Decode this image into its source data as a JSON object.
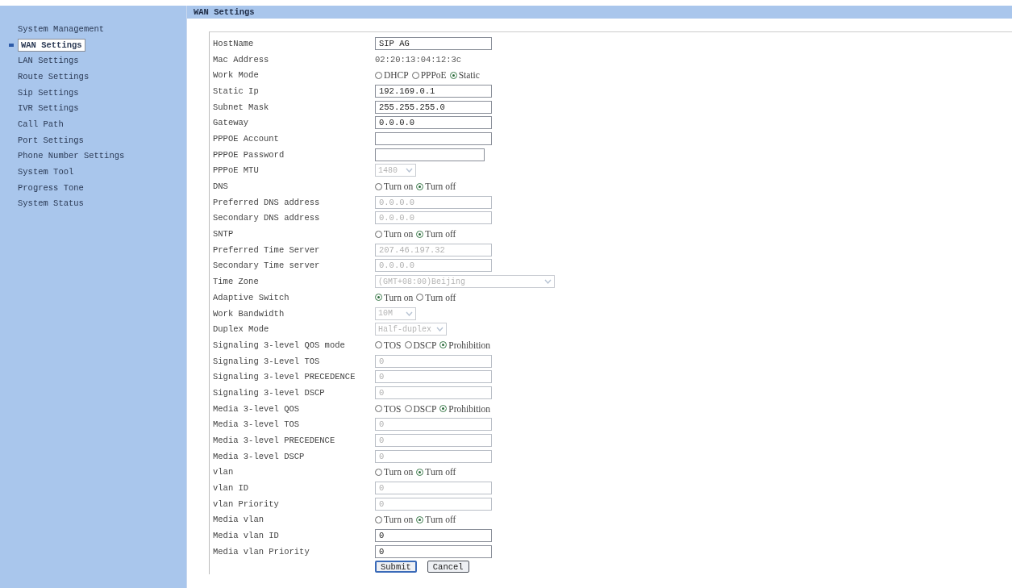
{
  "sidebar": {
    "items": [
      {
        "label": "System Management",
        "selected": false
      },
      {
        "label": "WAN Settings",
        "selected": true
      },
      {
        "label": "LAN Settings",
        "selected": false
      },
      {
        "label": "Route Settings",
        "selected": false
      },
      {
        "label": "Sip Settings",
        "selected": false
      },
      {
        "label": "IVR Settings",
        "selected": false
      },
      {
        "label": "Call Path",
        "selected": false
      },
      {
        "label": "Port Settings",
        "selected": false
      },
      {
        "label": "Phone Number Settings",
        "selected": false
      },
      {
        "label": "System Tool",
        "selected": false
      },
      {
        "label": "Progress Tone",
        "selected": false
      },
      {
        "label": "System Status",
        "selected": false
      }
    ]
  },
  "header": {
    "title": "WAN Settings"
  },
  "form": {
    "rows": [
      {
        "label": "HostName",
        "kind": "text",
        "value": "SIP AG",
        "disabled": false
      },
      {
        "label": "Mac Address",
        "kind": "static",
        "value": "02:20:13:04:12:3c"
      },
      {
        "label": "Work Mode",
        "kind": "radio",
        "options": [
          {
            "label": "DHCP",
            "selected": false
          },
          {
            "label": "PPPoE",
            "selected": false
          },
          {
            "label": "Static",
            "selected": true
          }
        ]
      },
      {
        "label": "Static Ip",
        "kind": "text",
        "value": "192.169.0.1",
        "disabled": false
      },
      {
        "label": "Subnet Mask",
        "kind": "text",
        "value": "255.255.255.0",
        "disabled": false
      },
      {
        "label": "Gateway",
        "kind": "text",
        "value": "0.0.0.0",
        "disabled": false
      },
      {
        "label": "PPPOE Account",
        "kind": "text",
        "disabled": false
      },
      {
        "label": "PPPOE Password",
        "kind": "password",
        "disabled": false
      },
      {
        "label": "PPPoE MTU",
        "kind": "select",
        "value": "1480",
        "disabled": true
      },
      {
        "label": "DNS",
        "kind": "radio",
        "options": [
          {
            "label": "Turn on",
            "selected": false
          },
          {
            "label": "Turn off",
            "selected": true
          }
        ]
      },
      {
        "label": "Preferred DNS address",
        "kind": "text",
        "value": "0.0.0.0",
        "disabled": true
      },
      {
        "label": "Secondary DNS address",
        "kind": "text",
        "value": "0.0.0.0",
        "disabled": true
      },
      {
        "label": "SNTP",
        "kind": "radio",
        "options": [
          {
            "label": "Turn on",
            "selected": false
          },
          {
            "label": "Turn off",
            "selected": true
          }
        ]
      },
      {
        "label": "Preferred Time Server",
        "kind": "text",
        "value": "207.46.197.32",
        "disabled": true
      },
      {
        "label": "Secondary Time server",
        "kind": "text",
        "value": "0.0.0.0",
        "disabled": true
      },
      {
        "label": "Time Zone",
        "kind": "select",
        "value": "(GMT+08:00)Beijing",
        "wide": true,
        "disabled": true
      },
      {
        "label": "Adaptive Switch",
        "kind": "radio",
        "options": [
          {
            "label": "Turn on",
            "selected": true
          },
          {
            "label": "Turn off",
            "selected": false
          }
        ]
      },
      {
        "label": "Work Bandwidth",
        "kind": "select",
        "value": "10M",
        "disabled": true
      },
      {
        "label": "Duplex Mode",
        "kind": "select",
        "value": "Half-duplex",
        "disabled": true
      },
      {
        "label": "Signaling 3-level QOS mode",
        "kind": "radio",
        "options": [
          {
            "label": "TOS",
            "selected": false
          },
          {
            "label": "DSCP",
            "selected": false
          },
          {
            "label": "Prohibition",
            "selected": true
          }
        ]
      },
      {
        "label": "Signaling 3-Level TOS",
        "kind": "text",
        "value": "0",
        "disabled": true
      },
      {
        "label": "Signaling 3-level PRECEDENCE",
        "kind": "text",
        "value": "0",
        "disabled": true
      },
      {
        "label": "Signaling 3-level DSCP",
        "kind": "text",
        "value": "0",
        "disabled": true
      },
      {
        "label": "Media 3-level QOS",
        "kind": "radio",
        "options": [
          {
            "label": "TOS",
            "selected": false
          },
          {
            "label": "DSCP",
            "selected": false
          },
          {
            "label": "Prohibition",
            "selected": true
          }
        ]
      },
      {
        "label": "Media 3-level TOS",
        "kind": "text",
        "value": "0",
        "disabled": true
      },
      {
        "label": "Media 3-level PRECEDENCE",
        "kind": "text",
        "value": "0",
        "disabled": true
      },
      {
        "label": "Media 3-level DSCP",
        "kind": "text",
        "value": "0",
        "disabled": true
      },
      {
        "label": "vlan",
        "kind": "radio",
        "options": [
          {
            "label": "Turn on",
            "selected": false
          },
          {
            "label": "Turn off",
            "selected": true
          }
        ]
      },
      {
        "label": "vlan ID",
        "kind": "text",
        "value": "0",
        "disabled": true
      },
      {
        "label": "vlan Priority",
        "kind": "text",
        "value": "0",
        "disabled": true
      },
      {
        "label": "Media vlan",
        "kind": "radio",
        "options": [
          {
            "label": "Turn on",
            "selected": false
          },
          {
            "label": "Turn off",
            "selected": true
          }
        ]
      },
      {
        "label": "Media vlan ID",
        "kind": "text",
        "value": "0",
        "disabled": false
      },
      {
        "label": "Media vlan Priority",
        "kind": "text",
        "value": "0",
        "disabled": false
      }
    ],
    "buttons": [
      {
        "label": "Submit",
        "kind": "submit"
      },
      {
        "label": "Cancel",
        "kind": "cancel"
      }
    ]
  }
}
